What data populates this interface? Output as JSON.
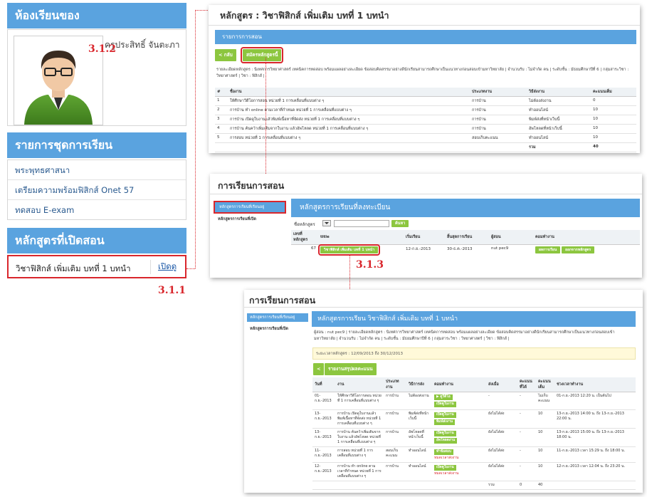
{
  "sidebar": {
    "classroom_heading": "ห้องเรียนของ",
    "teacher_name": "ครูประสิทธิ์ จันตะภา",
    "courseset_heading": "รายการชุดการเรียน",
    "courseset_items": [
      {
        "label": "พระพุทธศาสนา"
      },
      {
        "label": "เตรียมความพร้อมฟิสิกส์ Onet 57"
      },
      {
        "label": "ทดสอบ E-exam"
      }
    ],
    "open_heading": "หลักสูตรที่เปิดสอน",
    "open_course_title": "วิชาฟิสิกส์ เพิ่มเติม บทที่ 1 บทนำ",
    "open_course_link": "เปิดดู",
    "step_label": "3.1.1"
  },
  "shot1": {
    "title": "หลักสูตร : วิชาฟิสิกส์ เพิ่มเติม บทที่ 1 บทนำ",
    "bar": "รายการการสอน",
    "back_btn": "< กลับ",
    "apply_btn": "สมัครหลักสูตรนี้",
    "step_label": "3.1.2",
    "desc": "รายละเอียดหลักสูตร : นิเทศการวิทยาศาสตร์ เทคนิคการทดสอบ พร้อมแผลอย่างละเอียด ข้อสอบคิดสรรมาอย่างดีนักเรียนสามารถศึกษาเป็นแนวทางก่อนสอบเข้ามหาวิทยาลัย | จำนวนรับ : ไม่จำกัด คน | ระดับชั้น : มัธยมศึกษาปีที่ 6 | กลุ่มสาระวิชา : วิทยาศาสตร์ | วิชา : ฟิสิกส์ |",
    "columns": [
      "#",
      "ชื่องาน",
      "ประเภทงาน",
      "วิธีส่งงาน",
      "คะแนนเต็ม"
    ],
    "rows": [
      [
        "1",
        "ให้ศึกษาวีดีโอการสอน หน่วยที่ 1 การเคลื่อนที่แบบต่าง ๆ",
        "การบ้าน",
        "ไม่ต้องส่งงาน",
        "0"
      ],
      [
        "2",
        "การบ้าน ทำ online ตามเวลาที่กำหนด หน่วยที่ 1 การเคลื่อนที่แบบต่าง ๆ",
        "การบ้าน",
        "ทำออนไลน์",
        "10"
      ],
      [
        "3",
        "การบ้าน เปิดดูใบงานแล้วพิมพ์เนื้อหาที่จัดส่ง หน่วยที่ 1 การเคลื่อนที่แบบต่าง ๆ",
        "การบ้าน",
        "พิมพ์ส่งที่หน้าเว็บนี้",
        "10"
      ],
      [
        "4",
        "การบ้าน ค้นคว้าเพิ่มเติมจากใบงาน แล้วอัพโหลด หน่วยที่ 1 การเคลื่อนที่แบบต่าง ๆ",
        "การบ้าน",
        "อัพโหลดที่หน้าเว็บนี้",
        "10"
      ],
      [
        "5",
        "การสอบ หน่วยที่ 1 การเคลื่อนที่แบบต่าง ๆ",
        "สอบเก็บคะแนน",
        "ทำออนไลน์",
        "10"
      ]
    ],
    "total_label": "รวม",
    "total_value": "40"
  },
  "shot2": {
    "title": "การเรียนการสอน",
    "nav_active": "หลักสูตรการเรียนที่เรียนอยู่",
    "nav_other": "หลักสูตรการเรียนที่เปิด",
    "bar": "หลักสูตรการเรียนที่ลงทะเบียน",
    "filter_label": "ชื่อหลักสูตร",
    "search_btn": "ค้นหา",
    "columns": [
      "เลขที่หลักสูตร",
      "title",
      "เริ่มเรียน",
      "สิ้นสุดการเรียน",
      "ผู้สอน",
      "คอมทำงาน"
    ],
    "row": {
      "id": "67",
      "course": "วิชาฟิสิกส์ เพิ่มเติม บทที่ 1 บทนำ",
      "start": "12-ก.ย.-2013",
      "end": "30-ธ.ค.-2013",
      "teacher": "nut pec9",
      "btn1": "ผลการเรียน",
      "btn2": "ออกจากหลักสูตร"
    },
    "step_label": "3.1.3"
  },
  "shot3": {
    "title": "การเรียนการสอน",
    "nav_active": "หลักสูตรการเรียนที่เรียนอยู่",
    "nav_other": "หลักสูตรการเรียนที่เปิด",
    "bar": "หลักสูตรการเรียน วิชาฟิสิกส์ เพิ่มเติม บทที่ 1 บทนำ",
    "desc": "ผู้สอน : nut pec9 | รายละเอียดหลักสูตร : นิเทศการวิทยาศาสตร์ เทคนิคการทดสอบ พร้อมแผลอย่างละเอียด ข้อสอบคิดสรรมาอย่างดีนักเรียนสามารถศึกษาเป็นแนวทางก่อนสอบเข้ามหาวิทยาลัย | จำนวนรับ : ไม่จำกัด คน | ระดับชั้น : มัธยมศึกษาปีที่ 6 | กลุ่มสาระวิชา : วิทยาศาสตร์ | วิชา : ฟิสิกส์ |",
    "period": "ระยะเวลาหลักสูตร : 12/09/2013 ถึง 30/12/2013",
    "back_btn": "<",
    "report_btn": "รายงานสรุปผลคะแนน",
    "columns": [
      "วันที่",
      "งาน",
      "ประเภทงาน",
      "วิธีการส่ง",
      "คอมทำงาน",
      "ส่งเมื่อ",
      "คะแนนที่ได้",
      "คะแนนเต็ม",
      "ช่วงเวลาทำงาน"
    ],
    "rows": [
      {
        "date": "01-ก.ย.-2013",
        "task": "ให้ศึกษาวีดีโอการสอน หน่วยที่ 1 การเคลื่อนที่แบบต่าง ๆ",
        "type": "การบ้าน",
        "method": "ไม่ต้องส่งงาน",
        "actions": [
          "▶ ดูวีดีโอ",
          "เปิดดูใบงาน"
        ],
        "red": "",
        "sent": "-",
        "score": "-",
        "full": "ไม่เก็บคะแนน",
        "period": "01-ก.ย.-2013 12:20 น. เป็นต้นไป"
      },
      {
        "date": "13-ก.ย.-2013",
        "task": "การบ้าน เปิดดูใบงานแล้วพิมพ์เนื้อหาที่จัดส่ง หน่วยที่ 1 การเคลื่อนที่แบบต่าง ๆ",
        "type": "การบ้าน",
        "method": "พิมพ์ส่งที่หน้าเว็บนี้",
        "actions": [
          "เปิดดูใบงาน",
          "พิมพ์ส่งงาน"
        ],
        "red": "",
        "sent": "ยังไม่ได้ส่ง",
        "score": "-",
        "full": "10",
        "period": "13-ก.ย.-2013 14:00 น. ถึง 13-ก.ย.-2013 22:00 น."
      },
      {
        "date": "13-ก.ย.-2013",
        "task": "การบ้าน ค้นคว้าเพิ่มเติมจากใบงาน แล้วอัพโหลด หน่วยที่ 1 การเคลื่อนที่แบบต่าง ๆ",
        "type": "การบ้าน",
        "method": "อัพโหลดที่หน้าเว็บนี้",
        "actions": [
          "เปิดดูใบงาน",
          "อัพโหลดงาน"
        ],
        "red": "",
        "sent": "ยังไม่ได้ส่ง",
        "score": "-",
        "full": "10",
        "period": "13-ก.ย.-2013 15:00 น. ถึง 13-ก.ย.-2013 18:00 น."
      },
      {
        "date": "11-ก.ย.-2013",
        "task": "การสอบ หน่วยที่ 1 การเคลื่อนที่แบบต่าง ๆ",
        "type": "สอบเก็บคะแนน",
        "method": "ทำออนไลน์",
        "actions": [
          "ทำข้อสอบ"
        ],
        "red": "หมดเวลาส่งงาน",
        "sent": "ยังไม่ได้ส่ง",
        "score": "-",
        "full": "10",
        "period": "11-ก.ย.-2013 เวลา 15:29 น. ถึง 18:00 น."
      },
      {
        "date": "12-ก.ย.-2013",
        "task": "การบ้าน ทำ online ตามเวลาที่กำหนด หน่วยที่ 1 การเคลื่อนที่แบบต่าง ๆ",
        "type": "การบ้าน",
        "method": "ทำออนไลน์",
        "actions": [
          "เปิดดูใบงาน"
        ],
        "red": "หมดเวลาส่งงาน",
        "sent": "ยังไม่ได้ส่ง",
        "score": "-",
        "full": "10",
        "period": "12-ก.ย.-2013 เวลา 12:04 น. ถึง 23:20 น."
      }
    ],
    "total_label": "รวม",
    "total_score": "0",
    "total_full": "40"
  }
}
